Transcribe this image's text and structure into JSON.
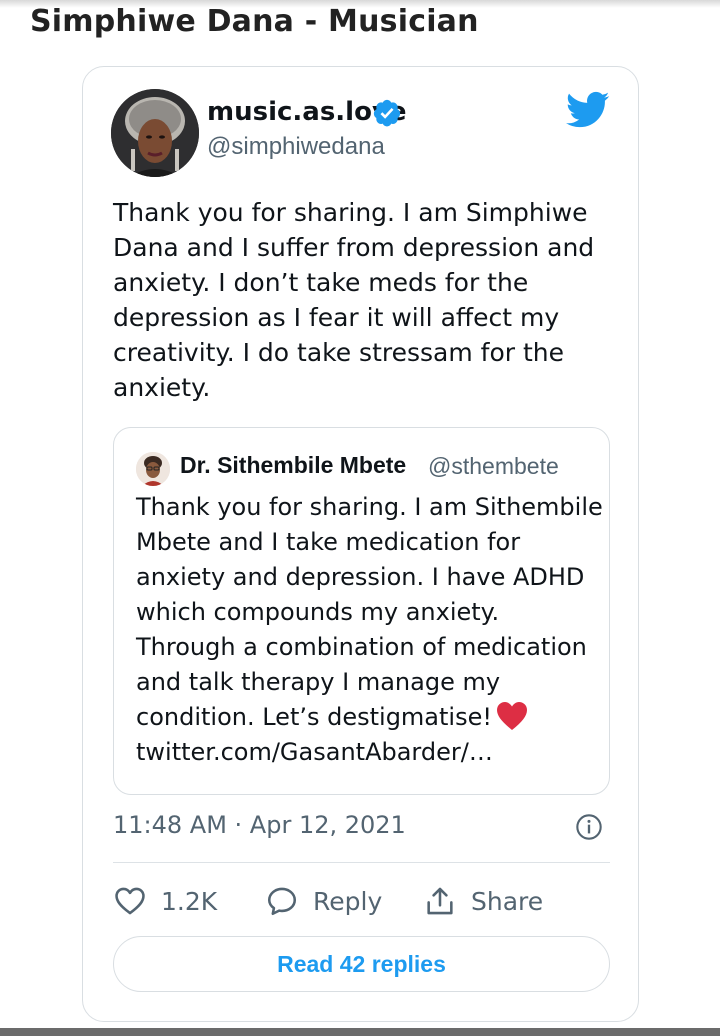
{
  "page": {
    "heading": "Simphiwe Dana - Musician"
  },
  "tweet": {
    "display_name": "music.as.love",
    "handle": "@simphiwedana",
    "verified": true,
    "text_lines": [
      "Thank you for sharing. I am Simphiwe",
      "Dana and I suffer from depression and",
      "anxiety. I don’t take meds for the",
      "depression as I fear it will affect my",
      "creativity. I do take stressam for the",
      "anxiety."
    ],
    "quoted": {
      "display_name": "Dr. Sithembile Mbete",
      "handle": "@sthembete",
      "text_lines": [
        "Thank you for sharing. I am Sithembile",
        "Mbete and I take medication for",
        "anxiety and depression. I have ADHD",
        "which compounds my anxiety.",
        "Through a combination of medication",
        "and talk therapy I manage my",
        "condition. Let’s destigmatise!",
        "twitter.com/GasantAbarder/…"
      ],
      "emoji": "red-heart"
    },
    "timestamp": "11:48 AM · Apr 12, 2021",
    "actions": {
      "likes": "1.2K",
      "reply_label": "Reply",
      "share_label": "Share"
    },
    "read_replies_label": "Read 42 replies"
  },
  "colors": {
    "accent": "#1d9bf0",
    "secondary_text": "#536471",
    "heart": "#e0245e"
  },
  "icons": [
    "twitter-bird-icon",
    "verified-badge-icon",
    "info-icon",
    "like-heart-icon",
    "reply-bubble-icon",
    "share-icon"
  ]
}
